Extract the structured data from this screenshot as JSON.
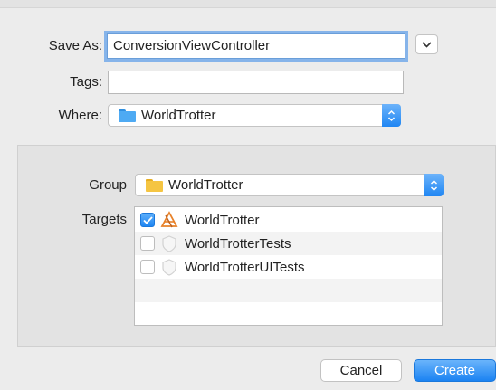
{
  "dialog": {
    "save_as_label": "Save As:",
    "save_as_value": "ConversionViewController",
    "tags_label": "Tags:",
    "tags_value": "",
    "where_label": "Where:",
    "where_value": "WorldTrotter",
    "where_folder_color": "#3aa0f0",
    "disclosure_icon": "chevron-down-icon"
  },
  "options": {
    "group_label": "Group",
    "group_value": "WorldTrotter",
    "group_folder_color": "#f5c542",
    "targets_label": "Targets",
    "targets": [
      {
        "name": "WorldTrotter",
        "checked": true,
        "icon": "app-target-icon"
      },
      {
        "name": "WorldTrotterTests",
        "checked": false,
        "icon": "test-target-icon"
      },
      {
        "name": "WorldTrotterUITests",
        "checked": false,
        "icon": "test-target-icon"
      }
    ]
  },
  "buttons": {
    "cancel": "Cancel",
    "create": "Create"
  },
  "colors": {
    "accent": "#1e85f2",
    "focus_ring": "#86b4ea"
  }
}
